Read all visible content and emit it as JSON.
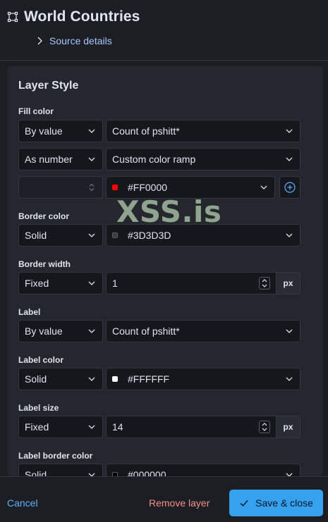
{
  "header": {
    "title": "World Countries",
    "source_details_label": "Source details"
  },
  "panel": {
    "title": "Layer Style",
    "fill_color": {
      "label": "Fill color",
      "mode": "By value",
      "field": "Count of pshitt*",
      "type": "As number",
      "ramp": "Custom color ramp",
      "stop_value": "",
      "stop_color": "#FF0000",
      "stop_swatch": "#FF0000"
    },
    "border_color": {
      "label": "Border color",
      "mode": "Solid",
      "color": "#3D3D3D",
      "swatch": "#3D3D3D"
    },
    "border_width": {
      "label": "Border width",
      "mode": "Fixed",
      "value": "1",
      "unit": "px"
    },
    "label": {
      "label": "Label",
      "mode": "By value",
      "field": "Count of pshitt*"
    },
    "label_color": {
      "label": "Label color",
      "mode": "Solid",
      "color": "#FFFFFF",
      "swatch": "#FFFFFF"
    },
    "label_size": {
      "label": "Label size",
      "mode": "Fixed",
      "value": "14",
      "unit": "px"
    },
    "label_border_color": {
      "label": "Label border color",
      "mode": "Solid",
      "color": "#000000",
      "swatch": "#000000"
    }
  },
  "watermark": "XSS.is",
  "footer": {
    "cancel_label": "Cancel",
    "remove_label": "Remove layer",
    "save_label": "Save & close"
  },
  "colors": {
    "accent": "#36A2EF",
    "link": "#5CB0FF",
    "danger": "#F68F85"
  }
}
